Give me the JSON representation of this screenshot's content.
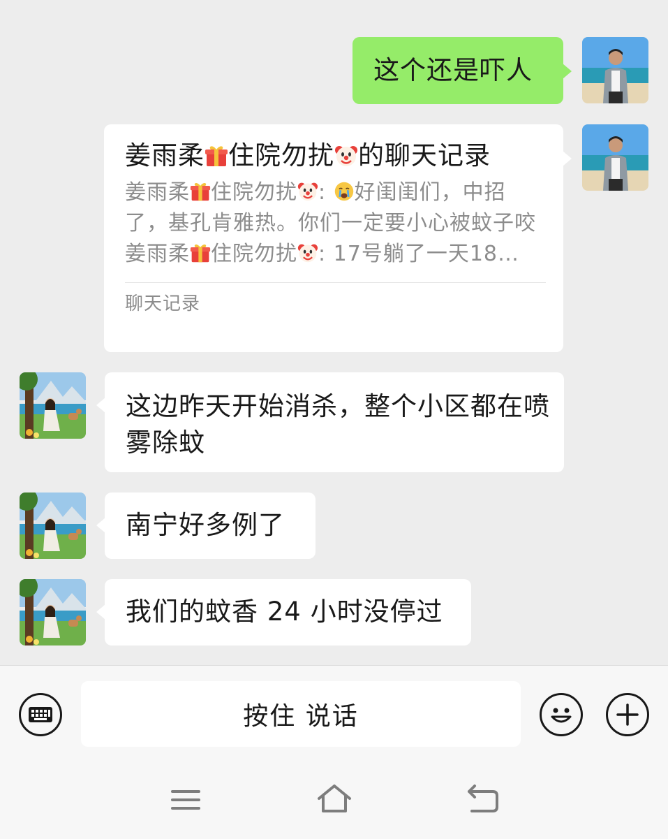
{
  "messages": {
    "m1": {
      "sender": "me",
      "text": "这个还是吓人"
    },
    "m2": {
      "sender": "me",
      "type": "chat-record",
      "title_a": "姜雨柔",
      "title_b": "住院勿扰",
      "title_c": "的聊天记录",
      "line1_name": "姜雨柔",
      "line1_name2": "住院勿扰",
      "line1_text": "好闺闺们，中招了，基孔肯雅热。你们一定要小心被蚊子咬",
      "line2_name": "姜雨柔",
      "line2_name2": "住院勿扰",
      "line2_text": ": 17号躺了一天18…",
      "footer": "聊天记录"
    },
    "m3": {
      "sender": "other",
      "text": "这边昨天开始消杀，整个小区都在喷雾除蚊"
    },
    "m4": {
      "sender": "other",
      "text": "南宁好多例了"
    },
    "m5": {
      "sender": "other",
      "text": "我们的蚊香 24 小时没停过"
    }
  },
  "input": {
    "hold_to_talk": "按住 说话"
  },
  "icons": {
    "keyboard": "keyboard-icon",
    "emoji": "emoji-icon",
    "plus": "plus-icon",
    "menu": "menu-icon",
    "home": "home-icon",
    "back": "back-icon"
  },
  "colors": {
    "background": "#ededed",
    "my_bubble": "#95ec69",
    "other_bubble": "#ffffff",
    "secondary_text": "#8c8c8c"
  }
}
